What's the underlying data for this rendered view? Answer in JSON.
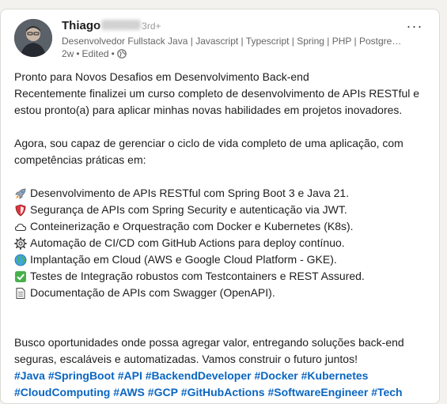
{
  "post": {
    "author": {
      "name": "Thiago",
      "connection_degree": "3rd+",
      "headline": "Desenvolvedor Fullstack Java | Javascript | Typescript | Spring | PHP | PostgreS...",
      "time": "2w",
      "edited": "Edited",
      "separator": "•",
      "visibility_icon": "globe-icon"
    },
    "more_label": "···",
    "title": "Pronto para Novos Desafios em Desenvolvimento Back-end",
    "intro": "Recentemente finalizei um curso completo de desenvolvimento de APIs RESTful e estou pronto(a) para aplicar minhas novas habilidades em projetos inovadores.",
    "competencies_intro": "Agora, sou capaz de gerenciar o ciclo de vida completo de uma aplicação, com competências práticas em:",
    "competencies": [
      {
        "icon": "rocket-icon",
        "text": "Desenvolvimento de APIs RESTful com Spring Boot 3 e Java 21."
      },
      {
        "icon": "shield-icon",
        "text": "Segurança de APIs com Spring Security e autenticação via JWT."
      },
      {
        "icon": "cloud-icon",
        "text": "Conteinerização e Orquestração com Docker e Kubernetes (K8s)."
      },
      {
        "icon": "gear-icon",
        "text": "Automação de CI/CD com GitHub Actions para deploy contínuo."
      },
      {
        "icon": "globe-icon",
        "text": "Implantação em Cloud (AWS e Google Cloud Platform - GKE)."
      },
      {
        "icon": "check-mark-icon",
        "text": "Testes de Integração robustos com Testcontainers e REST Assured."
      },
      {
        "icon": "document-icon",
        "text": "Documentação de APIs com Swagger (OpenAPI)."
      }
    ],
    "closing": "Busco oportunidades onde possa agregar valor, entregando soluções back-end seguras, escaláveis e automatizadas. Vamos construir o futuro juntos!",
    "hashtags_line1": [
      "#Java",
      "#SpringBoot",
      "#API",
      "#BackendDeveloper",
      "#Docker",
      "#Kubernetes"
    ],
    "hashtags_line2": [
      "#CloudComputing",
      "#AWS",
      "#GCP",
      "#GitHubActions",
      "#SoftwareEngineer",
      "#Tech"
    ],
    "colors": {
      "hashtag": "#0a66c2",
      "text": "#1d1d1d",
      "muted": "#666666",
      "background": "#f4f2ee",
      "card": "#ffffff"
    }
  }
}
